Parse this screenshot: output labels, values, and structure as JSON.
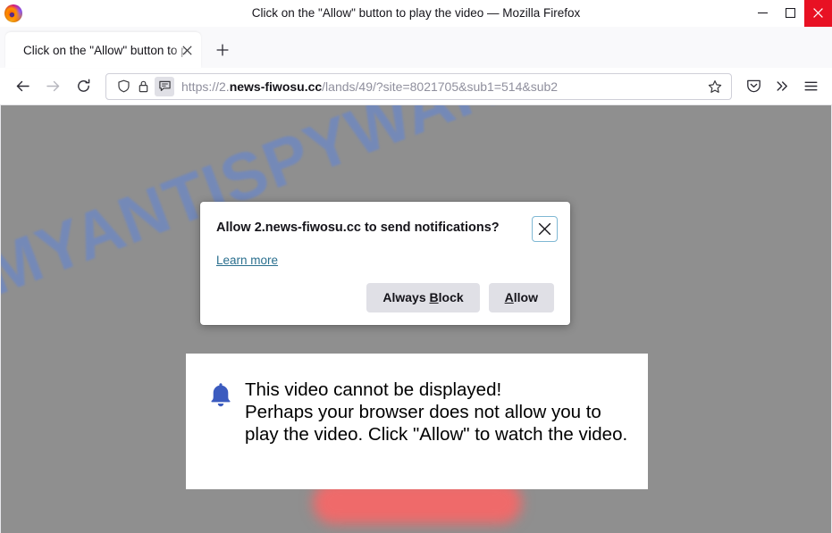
{
  "window": {
    "title": "Click on the \"Allow\" button to play the video — Mozilla Firefox",
    "logo_icon": "firefox-logo",
    "controls": {
      "minimize_icon": "minimize-icon",
      "maximize_icon": "maximize-icon",
      "close_icon": "close-icon",
      "close_bg": "#e81123"
    }
  },
  "tabstrip": {
    "tab_label": "Click on the \"Allow\" button to play the video",
    "tab_close_icon": "tab-close-icon",
    "newtab_icon": "plus-icon"
  },
  "navbar": {
    "back_icon": "back-arrow-icon",
    "forward_icon": "forward-arrow-icon",
    "reload_icon": "reload-icon",
    "shield_icon": "shield-icon",
    "lock_icon": "padlock-icon",
    "permission_icon": "notification-bubble-icon",
    "bookmark_icon": "star-icon",
    "pocket_icon": "pocket-icon",
    "overflow_icon": "double-chevron-icon",
    "menu_icon": "hamburger-menu-icon",
    "url": {
      "scheme": "https://2.",
      "domain": "news-fiwosu.cc",
      "path": "/lands/49/?site=8021705&sub1=514&sub2",
      "full": "https://2.news-fiwosu.cc/lands/49/?site=8021705&sub1=514&sub2"
    }
  },
  "doorhanger": {
    "title": "Allow 2.news-fiwosu.cc to send notifications?",
    "learn_more": "Learn more",
    "close_icon": "close-icon",
    "buttons": {
      "always_block": "Always Block",
      "always_block_accesskey": "B",
      "allow": "Allow",
      "allow_accesskey": "A"
    }
  },
  "page": {
    "background_color": "#8f8f8f",
    "watermark": "MYANTISPYWARE.COM",
    "watermark_color": "#6b87c7",
    "blurred_button_color": "#ef6a6a",
    "card": {
      "bell_icon": "bell-icon",
      "bell_color": "#3b5bbf",
      "line1": "This video cannot be displayed!",
      "line2": "Perhaps your browser does not allow you to play the video. Click \"Allow\" to watch the video."
    }
  }
}
